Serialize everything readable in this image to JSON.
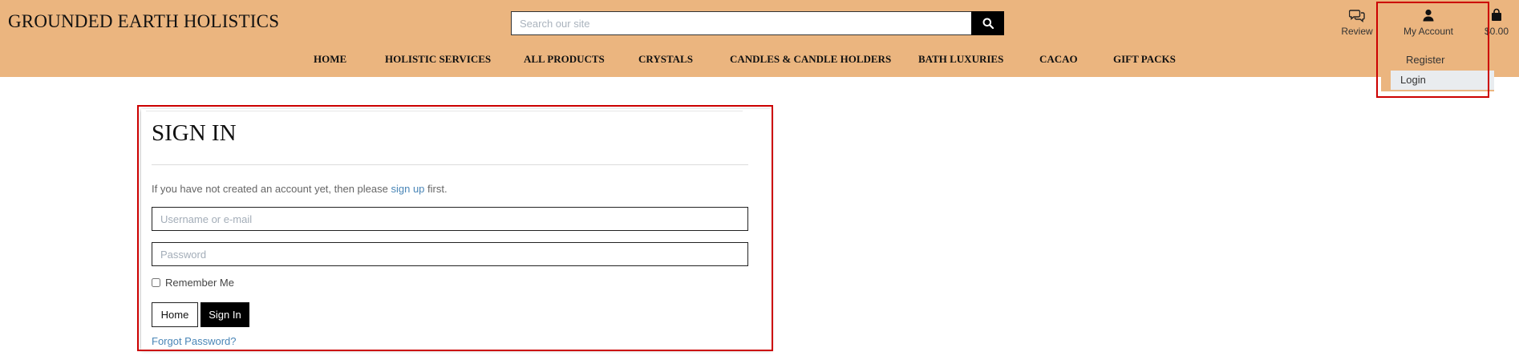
{
  "header": {
    "brand": "GROUNDED EARTH HOLISTICS",
    "search_placeholder": "Search our site",
    "nav": [
      "HOME",
      "HOLISTIC SERVICES",
      "ALL PRODUCTS",
      "CRYSTALS",
      "CANDLES & CANDLE HOLDERS",
      "BATH LUXURIES",
      "CACAO",
      "GIFT PACKS"
    ],
    "utilities": {
      "review": "Review",
      "account": "My Account",
      "cart_total": "$0.00"
    },
    "account_menu": {
      "register": "Register",
      "login": "Login"
    }
  },
  "signin": {
    "title": "SIGN IN",
    "intro_before": "If you have not created an account yet, then please ",
    "intro_link": "sign up",
    "intro_after": " first.",
    "username_placeholder": "Username or e-mail",
    "password_placeholder": "Password",
    "remember": "Remember Me",
    "home_button": "Home",
    "signin_button": "Sign In",
    "forgot": "Forgot Password?"
  },
  "colors": {
    "header_bg": "#ebb57f",
    "highlight": "#cc0000",
    "link": "#4a86b7",
    "button_dark": "#000000"
  },
  "icons": [
    "search-icon",
    "review-icon",
    "user-icon",
    "shopping-bag-icon"
  ]
}
